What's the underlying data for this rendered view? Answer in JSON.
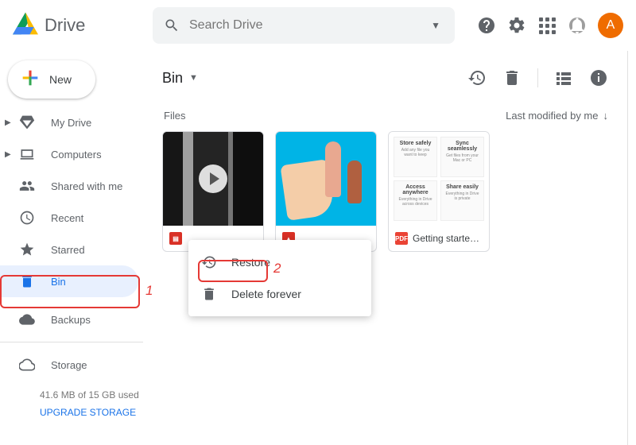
{
  "app": {
    "name": "Drive"
  },
  "search": {
    "placeholder": "Search Drive"
  },
  "header": {
    "avatar_initial": "A"
  },
  "new_button": {
    "label": "New"
  },
  "sidebar": {
    "items": [
      {
        "label": "My Drive"
      },
      {
        "label": "Computers"
      },
      {
        "label": "Shared with me"
      },
      {
        "label": "Recent"
      },
      {
        "label": "Starred"
      },
      {
        "label": "Bin"
      }
    ],
    "backups": {
      "label": "Backups"
    },
    "storage": {
      "label": "Storage",
      "used_text": "41.6 MB of 15 GB used",
      "upgrade_label": "UPGRADE STORAGE"
    }
  },
  "main": {
    "folder_title": "Bin",
    "files_label": "Files",
    "sort_label": "Last modified by me",
    "files": [
      {
        "name": "",
        "type": "video"
      },
      {
        "name": "",
        "type": "image"
      },
      {
        "name": "Getting starte…",
        "type": "pdf"
      }
    ]
  },
  "context_menu": {
    "restore": "Restore",
    "delete_forever": "Delete forever"
  },
  "doc_cells": {
    "a": "Store safely",
    "b": "Sync seamlessly",
    "c": "Access anywhere",
    "d": "Share easily"
  },
  "annotations": {
    "n1": "1",
    "n2": "2"
  }
}
